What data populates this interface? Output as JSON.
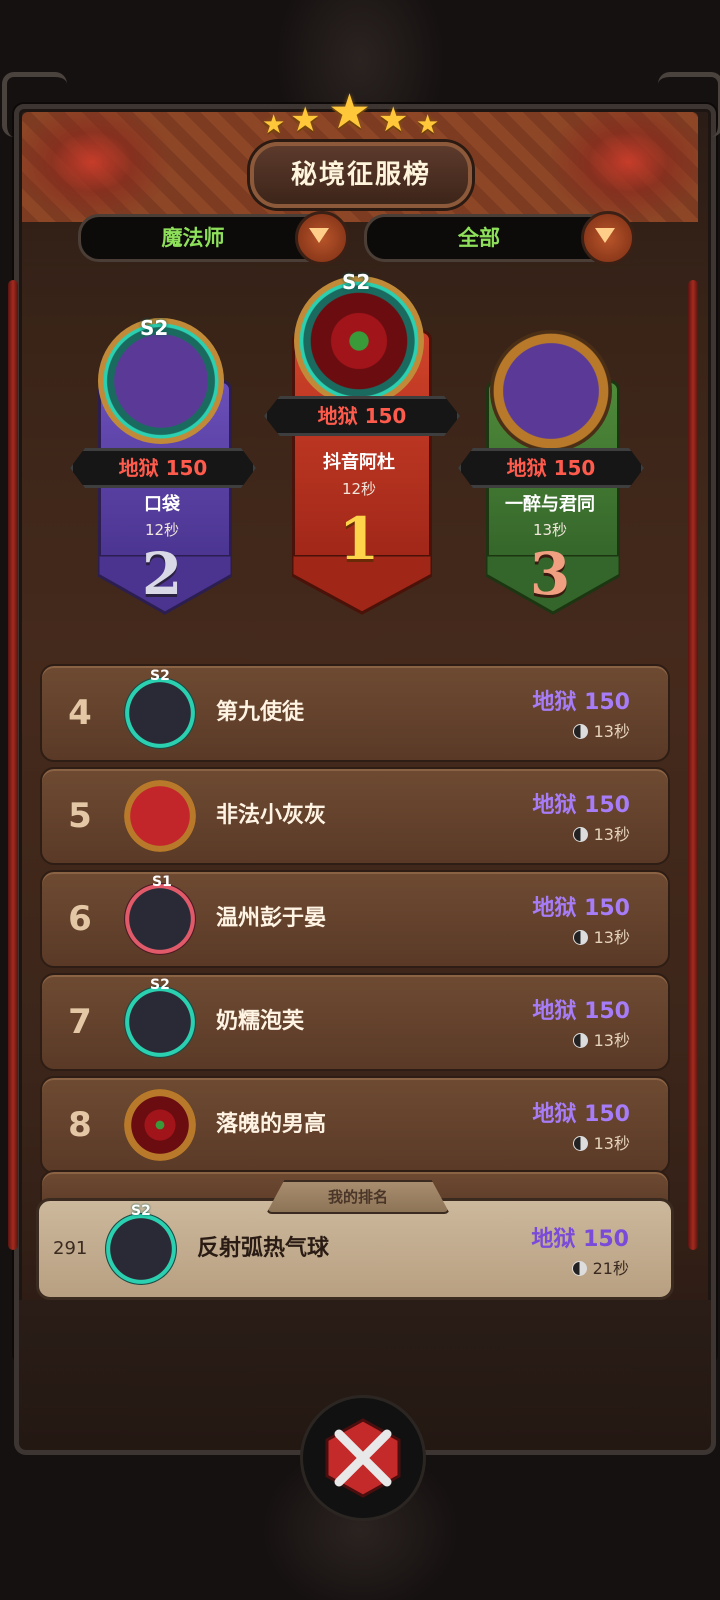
{
  "header": {
    "title": "秘境征服榜"
  },
  "filters": {
    "class_filter": "魔法师",
    "scope_filter": "全部"
  },
  "podium": {
    "first": {
      "season": "S2",
      "score": "地狱 150",
      "name": "抖音阿杜",
      "time": "12秒",
      "rank": "1"
    },
    "second": {
      "season": "S2",
      "score": "地狱 150",
      "name": "口袋",
      "time": "12秒",
      "rank": "2"
    },
    "third": {
      "score": "地狱 150",
      "name": "一醉与君同",
      "time": "13秒",
      "rank": "3"
    }
  },
  "rows": [
    {
      "rank": "4",
      "season": "S2",
      "name": "第九使徒",
      "score": "地狱 150",
      "time": "13秒"
    },
    {
      "rank": "5",
      "season": "",
      "name": "非法小灰灰",
      "score": "地狱 150",
      "time": "13秒"
    },
    {
      "rank": "6",
      "season": "S1",
      "name": "温州彭于晏",
      "score": "地狱 150",
      "time": "13秒"
    },
    {
      "rank": "7",
      "season": "S2",
      "name": "奶糯泡芙",
      "score": "地狱 150",
      "time": "13秒"
    },
    {
      "rank": "8",
      "season": "",
      "name": "落魄的男高",
      "score": "地狱 150",
      "time": "13秒"
    }
  ],
  "my_rank": {
    "label": "我的排名",
    "rank": "291",
    "season": "S2",
    "name": "反射弧热气球",
    "score": "地狱 150",
    "time": "21秒"
  },
  "colors": {
    "score_red": "#ff5b4d",
    "score_purple": "#a77cf7",
    "filter_green": "#8ee05a"
  }
}
